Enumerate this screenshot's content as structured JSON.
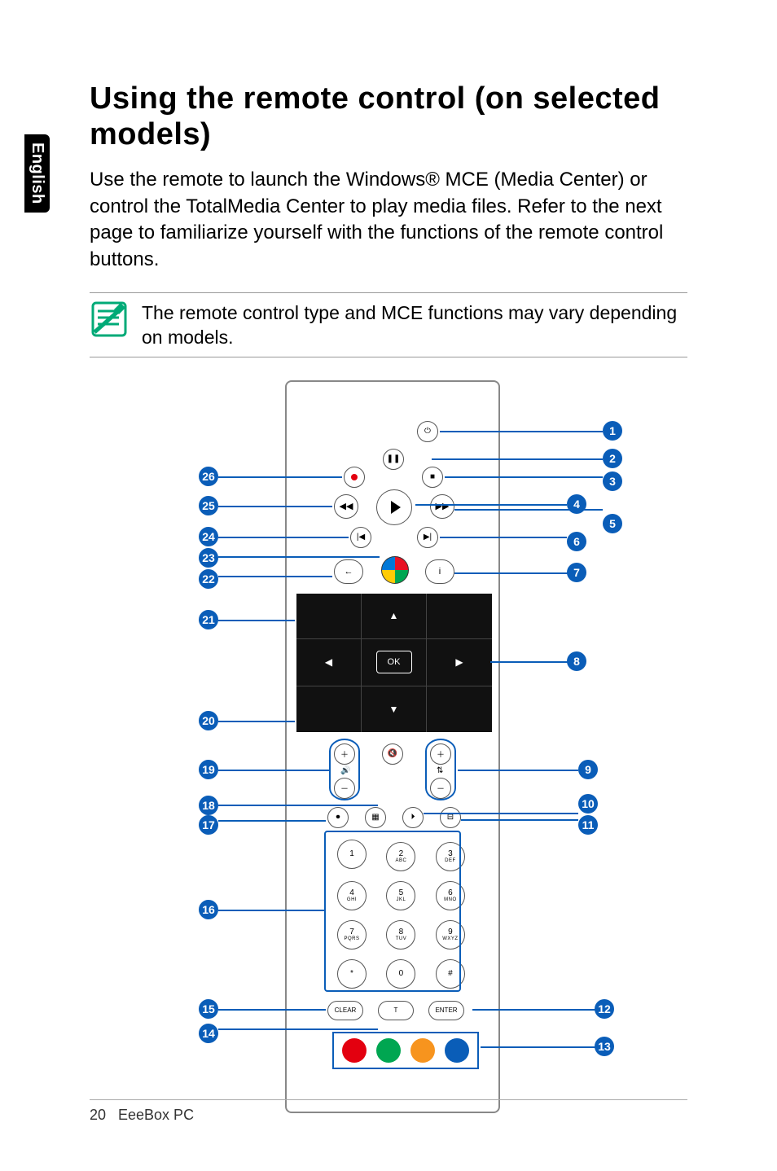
{
  "side_tab": "English",
  "heading": "Using the remote control (on selected models)",
  "intro": "Use the remote to launch the Windows® MCE (Media Center) or control the TotalMedia Center to play media files. Refer to the next page to familiarize yourself with the functions of the remote control buttons.",
  "note": "The remote control type and MCE functions may vary depending on models.",
  "remote": {
    "ok_label": "OK",
    "bottom_row": {
      "clear": "CLEAR",
      "teletext": "T",
      "enter": "ENTER"
    },
    "numpad": [
      [
        "1",
        ""
      ],
      [
        "2",
        "ABC"
      ],
      [
        "3",
        "DEF"
      ],
      [
        "4",
        "GHI"
      ],
      [
        "5",
        "JKL"
      ],
      [
        "6",
        "MNO"
      ],
      [
        "7",
        "PQRS"
      ],
      [
        "8",
        "TUV"
      ],
      [
        "9",
        "WXYZ"
      ],
      [
        "*",
        ""
      ],
      [
        "0",
        ""
      ],
      [
        "#",
        ""
      ]
    ],
    "color_buttons": [
      "#e3000f",
      "#00a651",
      "#f7941e",
      "#0a5db8"
    ]
  },
  "callouts_right": {
    "1": "1",
    "2": "2",
    "3": "3",
    "4": "4",
    "5": "5",
    "6": "6",
    "7": "7",
    "8": "8",
    "9": "9",
    "10": "10",
    "11": "11",
    "12": "12",
    "13": "13"
  },
  "callouts_left": {
    "14": "14",
    "15": "15",
    "16": "16",
    "17": "17",
    "18": "18",
    "19": "19",
    "20": "20",
    "21": "21",
    "22": "22",
    "23": "23",
    "24": "24",
    "25": "25",
    "26": "26"
  },
  "footer": {
    "page": "20",
    "title": "EeeBox PC"
  }
}
